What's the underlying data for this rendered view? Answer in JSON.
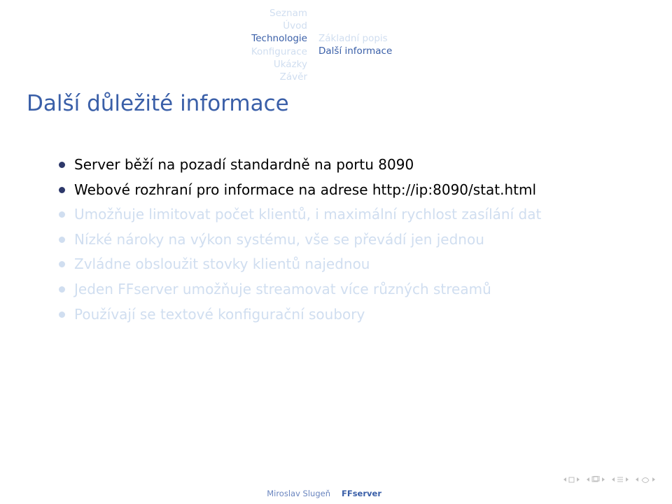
{
  "nav": {
    "left": [
      {
        "label": "Seznam",
        "active": false
      },
      {
        "label": "Úvod",
        "active": false
      },
      {
        "label": "Technologie",
        "active": true
      },
      {
        "label": "Konfigurace",
        "active": false
      },
      {
        "label": "Ukázky",
        "active": false
      },
      {
        "label": "Závěr",
        "active": false
      }
    ],
    "right": [
      {
        "label": "Základní popis",
        "active": false
      },
      {
        "label": "Další informace",
        "active": true
      }
    ]
  },
  "title": "Další důležité informace",
  "bullets": [
    {
      "text": "Server běží na pozadí standardně na portu 8090",
      "revealed": true
    },
    {
      "text": "Webové rozhraní pro informace na adrese http://ip:8090/stat.html",
      "revealed": true
    },
    {
      "text": "Umožňuje limitovat počet klientů, i maximální rychlost zasílání dat",
      "revealed": false
    },
    {
      "text": "Nízké nároky na výkon systému, vše se převádí jen jednou",
      "revealed": false
    },
    {
      "text": "Zvládne obsloužit stovky klientů najednou",
      "revealed": false
    },
    {
      "text": "Jeden FFserver umožňuje streamovat více různých streamů",
      "revealed": false
    },
    {
      "text": "Používají se textové konfigurační soubory",
      "revealed": false
    }
  ],
  "footer": {
    "author": "Miroslav Slugeň",
    "title": "FFserver"
  }
}
